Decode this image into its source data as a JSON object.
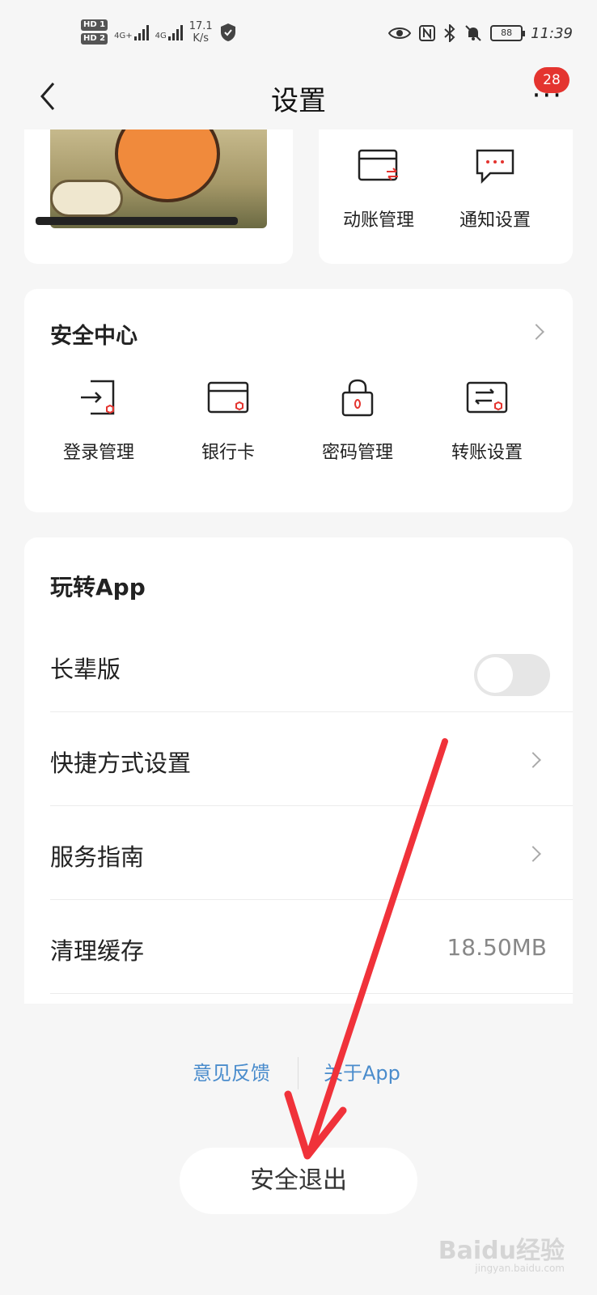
{
  "status_bar": {
    "sim1": "HD 1",
    "sim2": "HD 2",
    "net1": "4G+",
    "net2": "4G",
    "speed_value": "17.1",
    "speed_unit": "K/s",
    "battery": "88",
    "time": "11:39"
  },
  "header": {
    "title": "设置",
    "more_label": "···",
    "badge_count": "28"
  },
  "quick_actions": [
    {
      "label": "动账管理",
      "icon": "card-transfer-icon"
    },
    {
      "label": "通知设置",
      "icon": "message-icon"
    }
  ],
  "security": {
    "title": "安全中心",
    "items": [
      {
        "label": "登录管理",
        "icon": "login-icon"
      },
      {
        "label": "银行卡",
        "icon": "bank-card-icon"
      },
      {
        "label": "密码管理",
        "icon": "lock-icon"
      },
      {
        "label": "转账设置",
        "icon": "transfer-icon"
      }
    ]
  },
  "app_section": {
    "title": "玩转App",
    "rows": [
      {
        "label": "长辈版",
        "type": "toggle",
        "on": false
      },
      {
        "label": "快捷方式设置",
        "type": "chevron"
      },
      {
        "label": "服务指南",
        "type": "chevron"
      },
      {
        "label": "清理缓存",
        "type": "value",
        "value": "18.50MB"
      }
    ]
  },
  "footer": {
    "feedback": "意见反馈",
    "about": "关于App",
    "logout": "安全退出"
  },
  "watermark": {
    "main": "Baidu经验",
    "sub": "jingyan.baidu.com"
  },
  "colors": {
    "accent_red": "#e4342f",
    "link_blue": "#4a8ccc",
    "annotation_arrow": "#f0323a"
  }
}
